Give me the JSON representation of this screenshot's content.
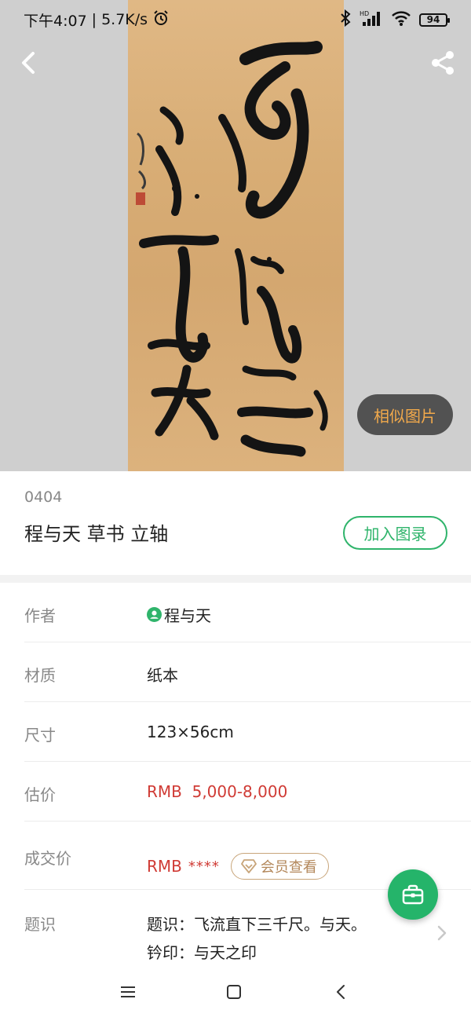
{
  "status": {
    "time": "下午4:07",
    "net_speed": "5.7K/s",
    "battery": "94",
    "icons": [
      "alarm-icon",
      "bluetooth-icon",
      "hd-signal-icon",
      "wifi-icon",
      "battery-icon"
    ]
  },
  "hero": {
    "similar_button": "相似图片",
    "icons": [
      "back-icon",
      "share-icon"
    ]
  },
  "item": {
    "lot_number": "0404",
    "title": "程与天 草书 立轴",
    "add_button": "加入图录"
  },
  "details": {
    "author": {
      "label": "作者",
      "value": "程与天"
    },
    "material": {
      "label": "材质",
      "value": "纸本"
    },
    "size": {
      "label": "尺寸",
      "value": "123×56cm"
    },
    "estimate": {
      "label": "估价",
      "value": "RMB  5,000-8,000"
    },
    "deal": {
      "label": "成交价",
      "currency": "RMB",
      "masked": "****",
      "member_button": "会员查看"
    },
    "inscription": {
      "label": "题识",
      "line1": "题识：飞流直下三千尺。与天。",
      "line2": "钤印：与天之印"
    }
  },
  "colors": {
    "accent_green": "#2fb46b",
    "price_red": "#d03b35",
    "member_gold": "#b3875a",
    "similar_orange": "#f2a94b"
  }
}
